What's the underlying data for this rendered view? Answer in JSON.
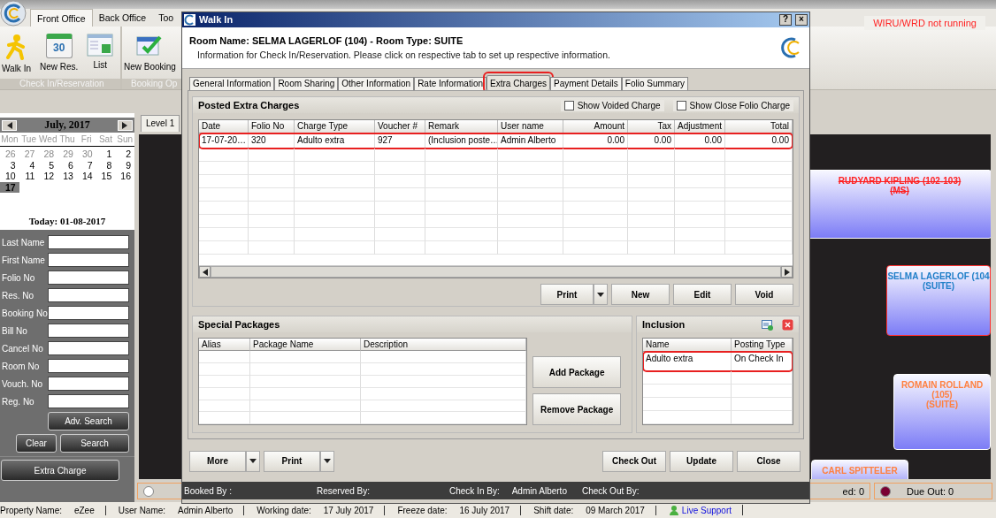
{
  "app": {
    "ribbon_tabs": [
      {
        "label": "Front Office",
        "selected": true
      },
      {
        "label": "Back Office",
        "selected": false
      },
      {
        "label": "Too",
        "selected": false
      }
    ],
    "service_status": "WIRU/WRD not running",
    "ribbon_groups": [
      {
        "label": "Check In/Reservation",
        "buttons": [
          {
            "kind": "walkin",
            "label": "Walk In"
          },
          {
            "kind": "calendar",
            "label": "New Res.",
            "badge": "30"
          },
          {
            "kind": "list",
            "label": "List"
          }
        ]
      },
      {
        "label": "Booking Op",
        "buttons": [
          {
            "kind": "booking",
            "label": "New Booking"
          }
        ]
      }
    ]
  },
  "calendar": {
    "month": "July, 2017",
    "weekdays": [
      "Mon",
      "Tue",
      "Wed",
      "Thu",
      "Fri",
      "Sat",
      "Sun"
    ],
    "weeks": [
      [
        {
          "day": "26",
          "muted": true,
          "selected": false
        },
        {
          "day": "27",
          "muted": true,
          "selected": false
        },
        {
          "day": "28",
          "muted": true,
          "selected": false
        },
        {
          "day": "29",
          "muted": true,
          "selected": false
        },
        {
          "day": "30",
          "muted": true,
          "selected": false
        },
        {
          "day": "1",
          "muted": false,
          "selected": false
        },
        {
          "day": "2",
          "muted": false,
          "selected": false
        }
      ],
      [
        {
          "day": "3",
          "muted": false,
          "selected": false
        },
        {
          "day": "4",
          "muted": false,
          "selected": false
        },
        {
          "day": "5",
          "muted": false,
          "selected": false
        },
        {
          "day": "6",
          "muted": false,
          "selected": false
        },
        {
          "day": "7",
          "muted": false,
          "selected": false
        },
        {
          "day": "8",
          "muted": false,
          "selected": false
        },
        {
          "day": "9",
          "muted": false,
          "selected": false
        }
      ],
      [
        {
          "day": "10",
          "muted": false,
          "selected": false
        },
        {
          "day": "11",
          "muted": false,
          "selected": false
        },
        {
          "day": "12",
          "muted": false,
          "selected": false
        },
        {
          "day": "13",
          "muted": false,
          "selected": false
        },
        {
          "day": "14",
          "muted": false,
          "selected": false
        },
        {
          "day": "15",
          "muted": false,
          "selected": false
        },
        {
          "day": "16",
          "muted": false,
          "selected": false
        }
      ],
      [
        {
          "day": "17",
          "muted": false,
          "selected": true
        }
      ]
    ],
    "today": "Today: 01-08-2017"
  },
  "search": {
    "fields": [
      {
        "label": "Last Name"
      },
      {
        "label": "First Name"
      },
      {
        "label": "Folio No"
      },
      {
        "label": "Res. No"
      },
      {
        "label": "Booking No"
      },
      {
        "label": "Bill No"
      },
      {
        "label": "Cancel No"
      },
      {
        "label": "Room No"
      },
      {
        "label": "Vouch. No"
      },
      {
        "label": "Reg. No"
      }
    ],
    "advanced_button": "Adv. Search",
    "clear_button": "Clear",
    "search_button": "Search"
  },
  "extra_charge_button": "Extra Charge",
  "floor": {
    "tabs": [
      {
        "label": "Level 1",
        "selected": true
      }
    ],
    "rooms": [
      {
        "lines": [
          "RUDYARD KIPLING (102-103)",
          "(MS)"
        ],
        "color": "#ff2020",
        "struck": true,
        "selected": false
      },
      {
        "lines": [
          "SELMA LAGERLOF (104",
          "(SUITE)"
        ],
        "color": "#1f7fc8",
        "struck": false,
        "selected": true
      },
      {
        "lines": [
          "ROMAIN ROLLAND",
          "(105)",
          "(SUITE)"
        ],
        "color": "#ff8040",
        "struck": false,
        "selected": false
      },
      {
        "lines": [
          "CARL SPITTELER"
        ],
        "color": "#ff8040",
        "struck": false,
        "selected": false
      }
    ],
    "legend": [
      {
        "color": "#ffffff"
      },
      {
        "label": "ed: 0"
      },
      {
        "label": "Due Out: 0",
        "color": "#7a0033"
      }
    ]
  },
  "dialog": {
    "title": "Walk In",
    "help_button": "?",
    "close_button": "×",
    "heading": "Room Name: SELMA LAGERLOF (104) - Room Type: SUITE",
    "subheading": "Information for Check In/Reservation. Please click on respective tab to set up respective information.",
    "tabs": [
      {
        "label": "General Information",
        "selected": false,
        "highlighted": false
      },
      {
        "label": "Room Sharing",
        "selected": false,
        "highlighted": false
      },
      {
        "label": "Other Information",
        "selected": false,
        "highlighted": false
      },
      {
        "label": "Rate Information",
        "selected": false,
        "highlighted": false
      },
      {
        "label": "Extra Charges",
        "selected": true,
        "highlighted": true
      },
      {
        "label": "Payment Details",
        "selected": false,
        "highlighted": false
      },
      {
        "label": "Folio Summary",
        "selected": false,
        "highlighted": false
      }
    ],
    "posted": {
      "title": "Posted Extra Charges",
      "options": [
        {
          "label": "Show Voided Charge",
          "checked": false
        },
        {
          "label": "Show Close Folio Charge",
          "checked": false
        }
      ],
      "columns": [
        {
          "label": "Date",
          "numeric": false
        },
        {
          "label": "Folio No",
          "numeric": false
        },
        {
          "label": "Charge Type",
          "numeric": false
        },
        {
          "label": "Voucher #",
          "numeric": false
        },
        {
          "label": "Remark",
          "numeric": false
        },
        {
          "label": "User name",
          "numeric": false
        },
        {
          "label": "Amount",
          "numeric": true
        },
        {
          "label": "Tax",
          "numeric": true
        },
        {
          "label": "Adjustment",
          "numeric": true
        },
        {
          "label": "Total",
          "numeric": true
        }
      ],
      "rows": [
        {
          "cells": [
            "17-07-20…",
            "320",
            "Adulto extra",
            "927",
            "(Inclusion poste…",
            "Admin Alberto",
            "0.00",
            "0.00",
            "0.00",
            "0.00"
          ],
          "highlighted": true
        }
      ],
      "buttons": [
        {
          "label": "Print",
          "dropdown": true
        },
        {
          "label": "New",
          "dropdown": false
        },
        {
          "label": "Edit",
          "dropdown": false
        },
        {
          "label": "Void",
          "dropdown": false
        }
      ]
    },
    "packages": {
      "title": "Special Packages",
      "columns": [
        "Alias",
        "Package Name",
        "Description"
      ],
      "buttons": [
        "Add Package",
        "Remove Package"
      ]
    },
    "inclusion": {
      "title": "Inclusion",
      "columns": [
        "Name",
        "Posting Type"
      ],
      "rows": [
        {
          "cells": [
            "Adulto extra",
            "On Check In"
          ],
          "highlighted": true
        }
      ]
    },
    "footer_left": [
      {
        "label": "More",
        "dropdown": true
      },
      {
        "label": "Print",
        "dropdown": true
      }
    ],
    "footer_right": [
      {
        "label": "Check Out",
        "dropdown": false
      },
      {
        "label": "Update",
        "dropdown": false
      },
      {
        "label": "Close",
        "dropdown": false
      }
    ],
    "info": [
      {
        "label": "Booked By :"
      },
      {
        "label": "Reserved By:"
      },
      {
        "label": "Check In By:",
        "value": "Admin Alberto"
      },
      {
        "label": "Check Out By:"
      }
    ]
  },
  "status_bar": [
    {
      "kind": "field",
      "label": "Property Name:",
      "value": "eZee"
    },
    {
      "kind": "field",
      "label": "User Name:",
      "value": "Admin Alberto"
    },
    {
      "kind": "field",
      "label": "Working date:",
      "value": "17 July 2017"
    },
    {
      "kind": "field",
      "label": "Freeze date:",
      "value": "16 July 2017"
    },
    {
      "kind": "field",
      "label": "Shift date:",
      "value": "09 March 2017"
    },
    {
      "kind": "link",
      "label": "Live Support"
    }
  ]
}
